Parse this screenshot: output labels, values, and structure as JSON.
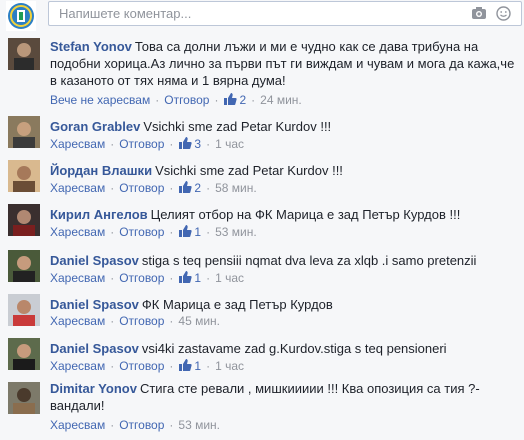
{
  "input": {
    "placeholder": "Напишете коментар..."
  },
  "comments": [
    {
      "author": "Stefan Yonov",
      "text": "Това са долни лъжи и ми е чудно как се дава трибуна на подобни хорица.Аз лично за първи път ги виждам и чувам и мога да кажа,че в казаното от тях няма и 1 вярна дума!",
      "like_label": "Вече не харесвам",
      "reply_label": "Отговор",
      "likes": "2",
      "time": "24 мин."
    },
    {
      "author": "Goran Grablev",
      "text": "Vsichki sme zad Petar Kurdov !!!",
      "like_label": "Харесвам",
      "reply_label": "Отговор",
      "likes": "3",
      "time": "1 час"
    },
    {
      "author": "Йордан Влашки",
      "text": "Vsichki sme zad Petar Kurdov !!!",
      "like_label": "Харесвам",
      "reply_label": "Отговор",
      "likes": "2",
      "time": "58 мин."
    },
    {
      "author": "Кирил Ангелов",
      "text": "Целият отбор на ФК Марица е зад Петър Курдов !!!",
      "like_label": "Харесвам",
      "reply_label": "Отговор",
      "likes": "1",
      "time": "53 мин."
    },
    {
      "author": "Daniel Spasov",
      "text": "stiga s teq pensiii nqmat dva leva za xlqb .i samo pretenzii",
      "like_label": "Харесвам",
      "reply_label": "Отговор",
      "likes": "1",
      "time": "1 час"
    },
    {
      "author": "Daniel Spasov",
      "text": "ФК Марица е зад Петър Курдов",
      "like_label": "Харесвам",
      "reply_label": "Отговор",
      "likes": "",
      "time": "45 мин."
    },
    {
      "author": "Daniel Spasov",
      "text": "vsi4ki zastavame zad g.Kurdov.stiga s teq pensioneri",
      "like_label": "Харесвам",
      "reply_label": "Отговор",
      "likes": "1",
      "time": "1 час"
    },
    {
      "author": "Dimitar Yonov",
      "text": "Стига сте ревали , мишкиииии !!! Ква опозиция са тия ?-вандали!",
      "like_label": "Харесвам",
      "reply_label": "Отговор",
      "likes": "",
      "time": "53 мин."
    }
  ],
  "colors": {
    "link": "#4267b2",
    "author": "#365899",
    "meta": "#90949c",
    "text": "#1d2129"
  },
  "icons": {
    "camera": "camera-icon",
    "emoji": "emoji-icon",
    "thumb": "thumbs-up-icon"
  }
}
